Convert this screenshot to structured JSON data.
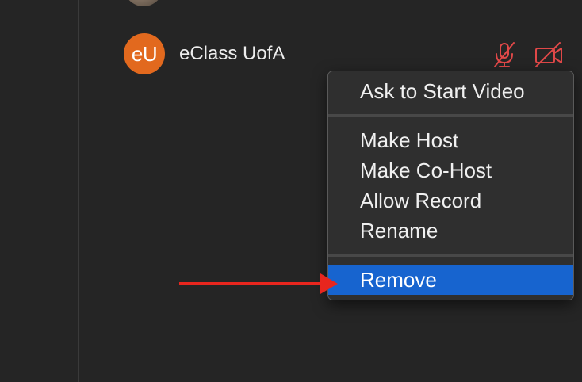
{
  "participant": {
    "initials": "eU",
    "name": "eClass UofA",
    "avatar_color": "#e2691e",
    "mic_status": "muted",
    "video_status": "off",
    "status_icon_color": "#e04848"
  },
  "context_menu": {
    "items": [
      {
        "label": "Ask to Start Video"
      },
      {
        "label": "Make Host"
      },
      {
        "label": "Make Co-Host"
      },
      {
        "label": "Allow Record"
      },
      {
        "label": "Rename"
      },
      {
        "label": "Remove",
        "highlighted": true
      }
    ],
    "highlight_color": "#1764cf"
  },
  "annotation": {
    "arrow_color": "#e8261e",
    "points_to": "Remove"
  }
}
